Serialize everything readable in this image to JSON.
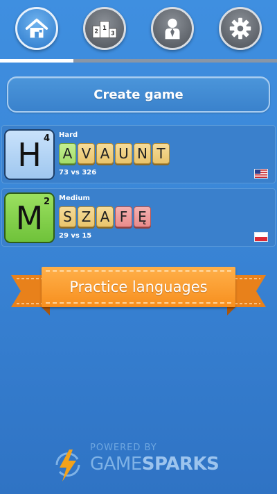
{
  "nav": {
    "items": [
      {
        "icon": "home-icon",
        "active": true
      },
      {
        "icon": "podium-icon",
        "active": false
      },
      {
        "icon": "profile-icon",
        "active": false
      },
      {
        "icon": "gear-icon",
        "active": false
      }
    ]
  },
  "create_game": {
    "label": "Create game"
  },
  "games": [
    {
      "big_letter": "H",
      "big_value": "4",
      "difficulty": "Hard",
      "letters": [
        "A",
        "V",
        "A",
        "U",
        "N",
        "T"
      ],
      "score": "73 vs 326",
      "flag": "us-flag-icon"
    },
    {
      "big_letter": "M",
      "big_value": "2",
      "difficulty": "Medium",
      "letters": [
        "S",
        "Z",
        "A",
        "F",
        "Ę"
      ],
      "score": "29 vs 15",
      "flag": "pl-flag-icon"
    }
  ],
  "practice": {
    "label": "Practice languages"
  },
  "powered": {
    "label": "POWERED BY",
    "brand_game": "GAME",
    "brand_sparks": "SPARKS"
  },
  "colors": {
    "accent": "#3f8fe0",
    "ribbon": "#f78f1e",
    "tile": "#e9c46c"
  }
}
